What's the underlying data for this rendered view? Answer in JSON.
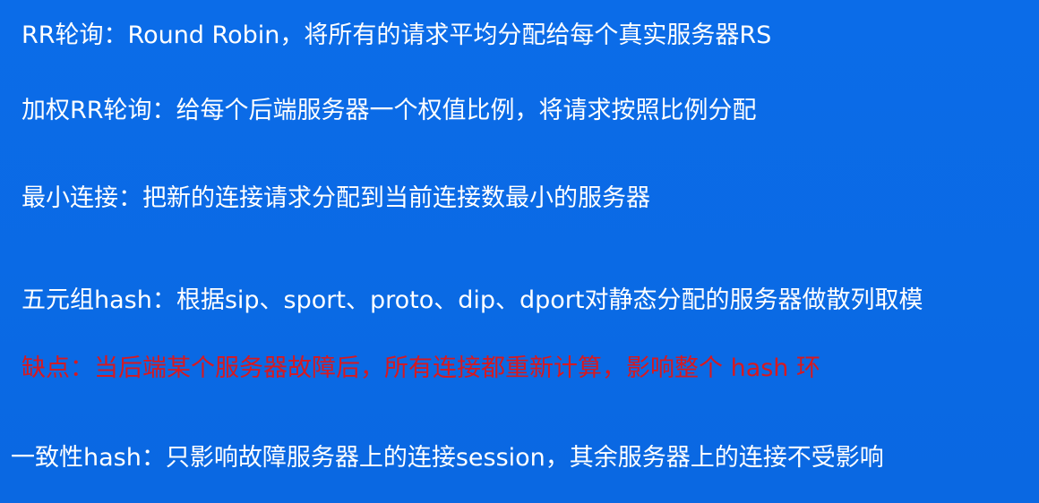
{
  "slide": {
    "lines": [
      "RR轮询：Round Robin，将所有的请求平均分配给每个真实服务器RS",
      "加权RR轮询：给每个后端服务器一个权值比例，将请求按照比例分配",
      "最小连接：把新的连接请求分配到当前连接数最小的服务器",
      "五元组hash：根据sip、sport、proto、dip、dport对静态分配的服务器做散列取模",
      "缺点：当后端某个服务器故障后，所有连接都重新计算，影响整个 hash 环",
      "一致性hash：只影响故障服务器上的连接session，其余服务器上的连接不受影响"
    ]
  },
  "colors": {
    "background": "#0a6ae6",
    "text": "#ffffff",
    "warning": "#d8191f"
  }
}
